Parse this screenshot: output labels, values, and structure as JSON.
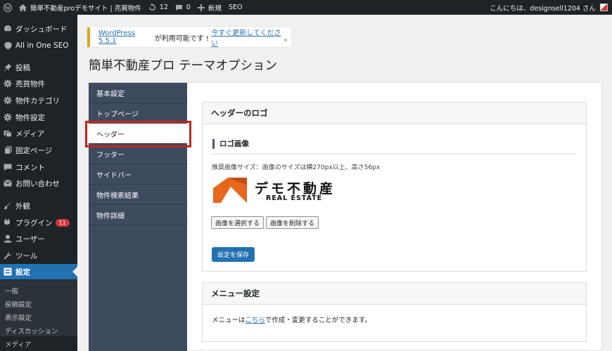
{
  "admin_bar": {
    "site_name": "簡単不動産proデモサイト | 売買物件",
    "updates_count": "12",
    "comments_count": "0",
    "new_label": "新規",
    "seo_label": "SEO",
    "greeting": "こんにちは、designsell1204 さん"
  },
  "sidebar": {
    "items": [
      {
        "label": "ダッシュボード",
        "icon": "dashboard-icon"
      },
      {
        "label": "All in One SEO",
        "icon": "shield-icon"
      },
      {
        "label": "投稿",
        "icon": "pin-icon"
      },
      {
        "label": "売買物件",
        "icon": "gear-icon"
      },
      {
        "label": "物件カテゴリ",
        "icon": "gear-icon"
      },
      {
        "label": "物件設定",
        "icon": "gear-icon"
      },
      {
        "label": "メディア",
        "icon": "media-icon"
      },
      {
        "label": "固定ページ",
        "icon": "page-icon"
      },
      {
        "label": "コメント",
        "icon": "comment-icon"
      },
      {
        "label": "お問い合わせ",
        "icon": "mail-icon"
      },
      {
        "label": "外観",
        "icon": "brush-icon"
      },
      {
        "label": "プラグイン",
        "icon": "plugin-icon",
        "badge": "11"
      },
      {
        "label": "ユーザー",
        "icon": "user-icon"
      },
      {
        "label": "ツール",
        "icon": "wrench-icon"
      },
      {
        "label": "設定",
        "icon": "settings-icon",
        "current": true
      }
    ],
    "submenu": [
      "一般",
      "投稿設定",
      "表示設定",
      "ディスカッション",
      "メディア"
    ]
  },
  "notice": {
    "version_link": "WordPress 5.5.1",
    "middle_text": " が利用可能です ! ",
    "update_link": "今すぐ更新してください",
    "end_text": "。"
  },
  "page_title": "簡単不動産プロ テーマオプション",
  "tabs": [
    "基本設定",
    "トップページ",
    "ヘッダー",
    "フッター",
    "サイドバー",
    "物件検索結果",
    "物件詳細"
  ],
  "active_tab": "ヘッダー",
  "header_logo": {
    "box_title": "ヘッダーのロゴ",
    "section_title": "ロゴ画像",
    "hint": "推奨画像サイズ：画像のサイズは横270px以上、高さ56px",
    "logo_text_jp": "デモ不動産",
    "logo_text_en": "REAL ESTATE",
    "select_button": "画像を選択する",
    "delete_button": "画像を削除する",
    "save_button": "設定を保存"
  },
  "menu_settings": {
    "box_title": "メニュー設定",
    "text_before": "メニューは",
    "link_text": "こちら",
    "text_after": "で作成・変更することができます。"
  },
  "colors": {
    "accent": "#2271b1",
    "admin_bg": "#1d2327",
    "tab_bg": "#3e4a5e",
    "highlight": "#c0281f",
    "logo_orange": "#e8671f",
    "badge": "#d63638"
  }
}
